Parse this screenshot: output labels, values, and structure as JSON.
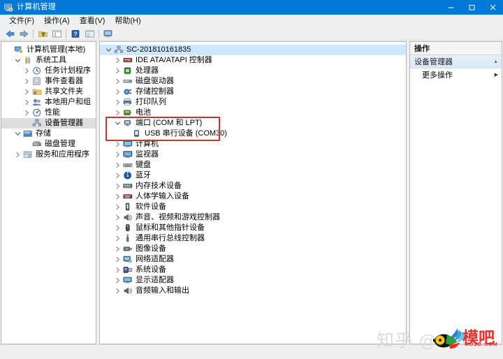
{
  "window": {
    "title": "计算机管理",
    "icon": "computer-management-icon",
    "controls": {
      "minimize": "–",
      "maximize": "□",
      "close": "✕"
    },
    "titlebar_color": "#0078d7"
  },
  "menubar": [
    {
      "label": "文件(F)",
      "name": "menu-file"
    },
    {
      "label": "操作(A)",
      "name": "menu-action"
    },
    {
      "label": "查看(V)",
      "name": "menu-view"
    },
    {
      "label": "帮助(H)",
      "name": "menu-help"
    }
  ],
  "toolbar": [
    {
      "name": "back-icon",
      "glyph": "←"
    },
    {
      "name": "forward-icon",
      "glyph": "→"
    },
    {
      "name": "up-folder-icon",
      "glyph": ""
    },
    {
      "name": "show-hide-tree-icon",
      "glyph": ""
    },
    {
      "name": "help-icon",
      "glyph": "?"
    },
    {
      "name": "properties-icon",
      "glyph": ""
    },
    {
      "name": "scan-hardware-icon",
      "glyph": ""
    }
  ],
  "sidebar": {
    "items": [
      {
        "label": "计算机管理(本地)",
        "icon": "computer-management-icon",
        "indent": 0,
        "twisty": "",
        "selected": false
      },
      {
        "label": "系统工具",
        "icon": "system-tools-icon",
        "indent": 1,
        "twisty": "open",
        "selected": false
      },
      {
        "label": "任务计划程序",
        "icon": "task-scheduler-icon",
        "indent": 2,
        "twisty": "closed",
        "selected": false
      },
      {
        "label": "事件查看器",
        "icon": "event-viewer-icon",
        "indent": 2,
        "twisty": "closed",
        "selected": false
      },
      {
        "label": "共享文件夹",
        "icon": "shared-folders-icon",
        "indent": 2,
        "twisty": "closed",
        "selected": false
      },
      {
        "label": "本地用户和组",
        "icon": "local-users-groups-icon",
        "indent": 2,
        "twisty": "closed",
        "selected": false
      },
      {
        "label": "性能",
        "icon": "performance-icon",
        "indent": 2,
        "twisty": "closed",
        "selected": false
      },
      {
        "label": "设备管理器",
        "icon": "device-manager-icon",
        "indent": 2,
        "twisty": "",
        "selected": true
      },
      {
        "label": "存储",
        "icon": "storage-icon",
        "indent": 1,
        "twisty": "open",
        "selected": false
      },
      {
        "label": "磁盘管理",
        "icon": "disk-management-icon",
        "indent": 2,
        "twisty": "",
        "selected": false
      },
      {
        "label": "服务和应用程序",
        "icon": "services-apps-icon",
        "indent": 1,
        "twisty": "closed",
        "selected": false
      }
    ]
  },
  "device_tree": {
    "root": {
      "label": "SC-201810161835",
      "icon": "computer-node-icon",
      "selected": true
    },
    "items": [
      {
        "label": "IDE ATA/ATAPI 控制器",
        "icon": "ide-controller-icon",
        "indent": 1,
        "twisty": "closed"
      },
      {
        "label": "处理器",
        "icon": "processor-icon",
        "indent": 1,
        "twisty": "closed"
      },
      {
        "label": "磁盘驱动器",
        "icon": "disk-drive-icon",
        "indent": 1,
        "twisty": "closed"
      },
      {
        "label": "存储控制器",
        "icon": "storage-controller-icon",
        "indent": 1,
        "twisty": "closed"
      },
      {
        "label": "打印队列",
        "icon": "print-queue-icon",
        "indent": 1,
        "twisty": "closed"
      },
      {
        "label": "电池",
        "icon": "battery-icon",
        "indent": 1,
        "twisty": "closed"
      },
      {
        "label": "端口 (COM 和 LPT)",
        "icon": "ports-icon",
        "indent": 1,
        "twisty": "open",
        "highlighted": true
      },
      {
        "label": "USB 串行设备 (COM30)",
        "icon": "serial-device-icon",
        "indent": 2,
        "twisty": "",
        "highlighted": true
      },
      {
        "label": "计算机",
        "icon": "computer-icon",
        "indent": 1,
        "twisty": "closed"
      },
      {
        "label": "监视器",
        "icon": "monitor-icon",
        "indent": 1,
        "twisty": "closed"
      },
      {
        "label": "键盘",
        "icon": "keyboard-icon",
        "indent": 1,
        "twisty": "closed"
      },
      {
        "label": "蓝牙",
        "icon": "bluetooth-icon",
        "indent": 1,
        "twisty": "closed"
      },
      {
        "label": "内存技术设备",
        "icon": "memory-device-icon",
        "indent": 1,
        "twisty": "closed"
      },
      {
        "label": "人体学输入设备",
        "icon": "hid-icon",
        "indent": 1,
        "twisty": "closed"
      },
      {
        "label": "软件设备",
        "icon": "software-device-icon",
        "indent": 1,
        "twisty": "closed"
      },
      {
        "label": "声音、视频和游戏控制器",
        "icon": "audio-video-game-icon",
        "indent": 1,
        "twisty": "closed"
      },
      {
        "label": "鼠标和其他指针设备",
        "icon": "mouse-icon",
        "indent": 1,
        "twisty": "closed"
      },
      {
        "label": "通用串行总线控制器",
        "icon": "usb-controller-icon",
        "indent": 1,
        "twisty": "closed"
      },
      {
        "label": "图像设备",
        "icon": "imaging-device-icon",
        "indent": 1,
        "twisty": "closed"
      },
      {
        "label": "网络适配器",
        "icon": "network-adapter-icon",
        "indent": 1,
        "twisty": "closed"
      },
      {
        "label": "系统设备",
        "icon": "system-device-icon",
        "indent": 1,
        "twisty": "closed"
      },
      {
        "label": "显示适配器",
        "icon": "display-adapter-icon",
        "indent": 1,
        "twisty": "closed"
      },
      {
        "label": "音频输入和输出",
        "icon": "audio-io-icon",
        "indent": 1,
        "twisty": "closed"
      }
    ]
  },
  "actions_pane": {
    "header": "操作",
    "group_title": "设备管理器",
    "group_collapse_glyph": "▲",
    "items": [
      {
        "label": "更多操作",
        "submenu_glyph": "▶",
        "name": "action-more-actions"
      }
    ]
  },
  "annotation": {
    "highlight_color": "#c0392b",
    "target": "端口 (COM 和 LPT) / USB 串行设备 (COM30)"
  },
  "watermark": {
    "zhihu_text": "知乎 @",
    "brand_cn": "模吧",
    "brand_domain": "MOZB.COM",
    "brand_color": "#e8312a"
  }
}
